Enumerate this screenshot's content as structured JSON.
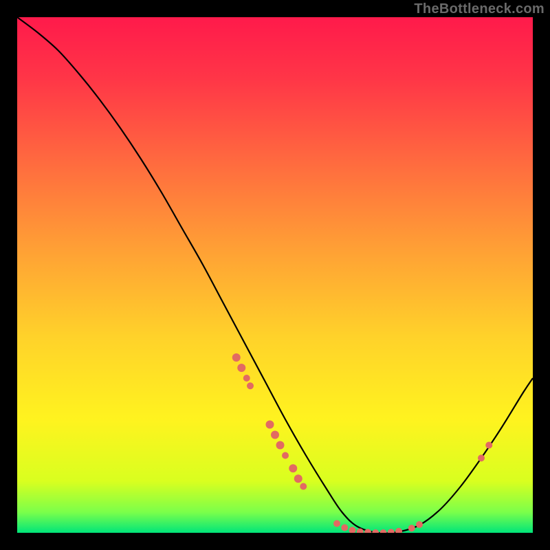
{
  "watermark": "TheBottleneck.com",
  "chart_data": {
    "type": "line",
    "title": "",
    "xlabel": "",
    "ylabel": "",
    "xlim": [
      0,
      100
    ],
    "ylim": [
      0,
      100
    ],
    "background_gradient": {
      "stops": [
        {
          "offset": 0.0,
          "color": "#ff1a4b"
        },
        {
          "offset": 0.12,
          "color": "#ff3647"
        },
        {
          "offset": 0.28,
          "color": "#ff6a3f"
        },
        {
          "offset": 0.45,
          "color": "#ffa035"
        },
        {
          "offset": 0.62,
          "color": "#ffd22a"
        },
        {
          "offset": 0.78,
          "color": "#fff31f"
        },
        {
          "offset": 0.9,
          "color": "#d9ff1f"
        },
        {
          "offset": 0.96,
          "color": "#7bff4a"
        },
        {
          "offset": 1.0,
          "color": "#00e57a"
        }
      ]
    },
    "series": [
      {
        "name": "bottleneck-curve",
        "color": "#000000",
        "x": [
          0,
          4,
          8,
          12,
          16,
          20,
          24,
          28,
          32,
          36,
          40,
          44,
          48,
          52,
          56,
          60,
          63,
          66,
          70,
          74,
          78,
          82,
          86,
          90,
          94,
          98,
          100
        ],
        "y": [
          100,
          97,
          93.5,
          89,
          84,
          78.5,
          72.5,
          66,
          59,
          52,
          44.5,
          37,
          29.5,
          22,
          15,
          8.5,
          4,
          1.2,
          0,
          0.2,
          1.5,
          4.5,
          9,
          14.5,
          20.5,
          27,
          30
        ]
      }
    ],
    "scatter_clusters": [
      {
        "name": "cluster-upper-left-branch",
        "color": "#e26a62",
        "points": [
          {
            "x": 42.5,
            "y": 34.0,
            "r": 6
          },
          {
            "x": 43.5,
            "y": 32.0,
            "r": 6
          },
          {
            "x": 44.5,
            "y": 30.0,
            "r": 5
          },
          {
            "x": 45.2,
            "y": 28.5,
            "r": 5
          }
        ]
      },
      {
        "name": "cluster-mid-left-branch",
        "color": "#e26a62",
        "points": [
          {
            "x": 49.0,
            "y": 21.0,
            "r": 6
          },
          {
            "x": 50.0,
            "y": 19.0,
            "r": 6
          },
          {
            "x": 51.0,
            "y": 17.0,
            "r": 6
          },
          {
            "x": 52.0,
            "y": 15.0,
            "r": 5
          },
          {
            "x": 53.5,
            "y": 12.5,
            "r": 6
          },
          {
            "x": 54.5,
            "y": 10.5,
            "r": 6
          },
          {
            "x": 55.5,
            "y": 9.0,
            "r": 5
          }
        ]
      },
      {
        "name": "cluster-valley-floor",
        "color": "#e26a62",
        "points": [
          {
            "x": 62.0,
            "y": 1.8,
            "r": 5
          },
          {
            "x": 63.5,
            "y": 1.0,
            "r": 5
          },
          {
            "x": 65.0,
            "y": 0.5,
            "r": 5
          },
          {
            "x": 66.5,
            "y": 0.2,
            "r": 5
          },
          {
            "x": 68.0,
            "y": 0.1,
            "r": 5
          },
          {
            "x": 69.5,
            "y": 0.0,
            "r": 5
          },
          {
            "x": 71.0,
            "y": 0.0,
            "r": 5
          },
          {
            "x": 72.5,
            "y": 0.1,
            "r": 5
          },
          {
            "x": 74.0,
            "y": 0.3,
            "r": 5
          },
          {
            "x": 76.5,
            "y": 0.9,
            "r": 5
          },
          {
            "x": 78.0,
            "y": 1.6,
            "r": 5
          }
        ]
      },
      {
        "name": "cluster-right-branch",
        "color": "#e26a62",
        "points": [
          {
            "x": 90.0,
            "y": 14.5,
            "r": 5
          },
          {
            "x": 91.5,
            "y": 17.0,
            "r": 5
          }
        ]
      }
    ]
  }
}
